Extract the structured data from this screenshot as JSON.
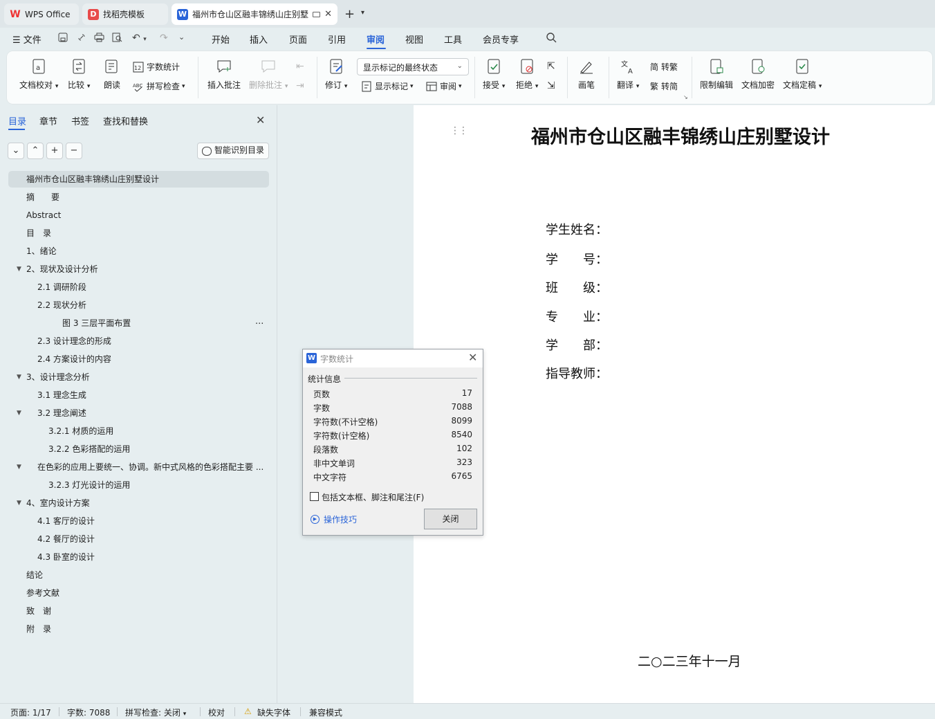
{
  "tabs": [
    {
      "label": "WPS Office",
      "icon": "wps-logo-icon"
    },
    {
      "label": "找稻壳模板",
      "icon": "docer-icon"
    },
    {
      "label": "福州市仓山区融丰锦绣山庄别墅",
      "icon": "writer-doc-icon"
    }
  ],
  "menu": {
    "file": "文件",
    "items": [
      "开始",
      "插入",
      "页面",
      "引用",
      "审阅",
      "视图",
      "工具",
      "会员专享"
    ],
    "active": "审阅"
  },
  "ribbon": {
    "doc_check": "文档校对",
    "compare": "比较",
    "read_aloud": "朗读",
    "word_count": "字数统计",
    "spell_check": "拼写检查",
    "insert_comment": "插入批注",
    "delete_comment": "删除批注",
    "revise": "修订",
    "show_state": "显示标记的最终状态",
    "show_markup": "显示标记",
    "review": "审阅",
    "accept": "接受",
    "reject": "拒绝",
    "pen": "画笔",
    "translate": "翻译",
    "to_traditional": "转繁",
    "to_simplified": "转简",
    "restrict_edit": "限制编辑",
    "encrypt": "文档加密",
    "finalize": "文档定稿"
  },
  "nav": {
    "tabs": [
      "目录",
      "章节",
      "书签",
      "查找和替换"
    ],
    "smart_toc": "智能识别目录",
    "items": [
      {
        "text": "福州市仓山区融丰锦绣山庄别墅设计",
        "level": 0,
        "toggle": "",
        "selected": true
      },
      {
        "text": "摘　　要",
        "level": 0,
        "toggle": ""
      },
      {
        "text": "Abstract",
        "level": 0,
        "toggle": ""
      },
      {
        "text": "目　录",
        "level": 0,
        "toggle": ""
      },
      {
        "text": "1、绪论",
        "level": 0,
        "toggle": ""
      },
      {
        "text": "2、现状及设计分析",
        "level": 0,
        "toggle": "▼"
      },
      {
        "text": "2.1 调研阶段",
        "level": 1,
        "toggle": ""
      },
      {
        "text": "2.2 现状分析",
        "level": 1,
        "toggle": ""
      },
      {
        "text": "图 3 三层平面布置",
        "level": 3,
        "toggle": "",
        "more": "..."
      },
      {
        "text": "2.3 设计理念的形成",
        "level": 1,
        "toggle": ""
      },
      {
        "text": "2.4 方案设计的内容",
        "level": 1,
        "toggle": ""
      },
      {
        "text": "3、设计理念分析",
        "level": 0,
        "toggle": "▼"
      },
      {
        "text": "3.1 理念生成",
        "level": 1,
        "toggle": ""
      },
      {
        "text": "3.2 理念阐述",
        "level": 1,
        "toggle": "▼"
      },
      {
        "text": "3.2.1 材质的运用",
        "level": 2,
        "toggle": ""
      },
      {
        "text": "3.2.2 色彩搭配的运用",
        "level": 2,
        "toggle": ""
      },
      {
        "text": "在色彩的应用上要统一、协调。新中式风格的色彩搭配主要 ...",
        "level": 1,
        "toggle": "▼"
      },
      {
        "text": "3.2.3 灯光设计的运用",
        "level": 2,
        "toggle": ""
      },
      {
        "text": "4、室内设计方案",
        "level": 0,
        "toggle": "▼"
      },
      {
        "text": "4.1 客厅的设计",
        "level": 1,
        "toggle": ""
      },
      {
        "text": "4.2 餐厅的设计",
        "level": 1,
        "toggle": ""
      },
      {
        "text": "4.3 卧室的设计",
        "level": 1,
        "toggle": ""
      },
      {
        "text": "结论",
        "level": 0,
        "toggle": ""
      },
      {
        "text": "参考文献",
        "level": 0,
        "toggle": ""
      },
      {
        "text": "致　谢",
        "level": 0,
        "toggle": ""
      },
      {
        "text": "附　录",
        "level": 0,
        "toggle": ""
      }
    ]
  },
  "document": {
    "title": "福州市仓山区融丰锦绣山庄别墅设计",
    "fields": [
      "学生姓名：",
      "学　　号：",
      "班　　级：",
      "专　　业：",
      "学　　部：",
      "指导教师："
    ],
    "date": "二○二三年十一月"
  },
  "dialog": {
    "title": "字数统计",
    "section": "统计信息",
    "stats": [
      {
        "label": "页数",
        "value": "17"
      },
      {
        "label": "字数",
        "value": "7088"
      },
      {
        "label": "字符数(不计空格)",
        "value": "8099"
      },
      {
        "label": "字符数(计空格)",
        "value": "8540"
      },
      {
        "label": "段落数",
        "value": "102"
      },
      {
        "label": "非中文单词",
        "value": "323"
      },
      {
        "label": "中文字符",
        "value": "6765"
      }
    ],
    "checkbox": "包括文本框、脚注和尾注(F)",
    "tips": "操作技巧",
    "close": "关闭"
  },
  "status": {
    "page": "页面: 1/17",
    "words": "字数: 7088",
    "spell": "拼写检查: 关闭",
    "proof": "校对",
    "missing_font": "缺失字体",
    "compat": "兼容模式"
  }
}
